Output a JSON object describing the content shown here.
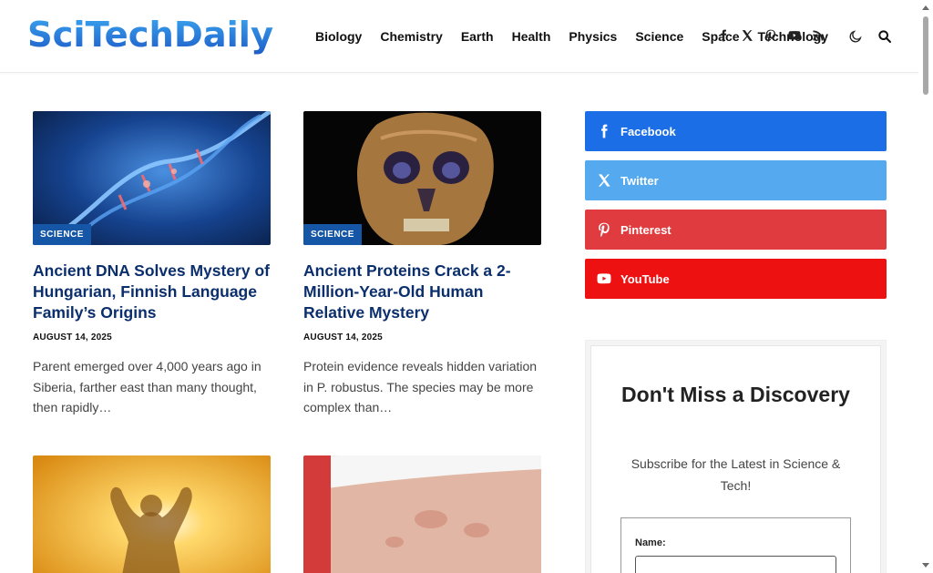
{
  "site": {
    "logo_text": "SciTechDaily"
  },
  "nav": {
    "items": [
      "Biology",
      "Chemistry",
      "Earth",
      "Health",
      "Physics",
      "Science",
      "Space",
      "Technology"
    ]
  },
  "header_social": [
    "facebook-icon",
    "x-twitter-icon",
    "pinterest-icon",
    "youtube-icon",
    "rss-icon"
  ],
  "header_tools": [
    "dark-mode-icon",
    "search-icon"
  ],
  "articles": [
    {
      "category": "SCIENCE",
      "title": "Ancient DNA Solves Mystery of Hungarian, Finnish Language Family’s Origins",
      "date": "AUGUST 14, 2025",
      "excerpt": "Parent emerged over 4,000 years ago in Siberia, farther east than many thought, then rapidly…"
    },
    {
      "category": "SCIENCE",
      "title": "Ancient Proteins Crack a 2-Million-Year-Old Human Relative Mystery",
      "date": "AUGUST 14, 2025",
      "excerpt": "Protein evidence reveals hidden variation in P. robustus. The species may be more complex than…"
    },
    {
      "category": "",
      "title": "",
      "date": "",
      "excerpt": ""
    },
    {
      "category": "",
      "title": "",
      "date": "",
      "excerpt": ""
    }
  ],
  "sidebar": {
    "social_buttons": [
      {
        "label": "Facebook",
        "icon": "facebook-icon",
        "color": "#1b6ee6"
      },
      {
        "label": "Twitter",
        "icon": "x-twitter-icon",
        "color": "#55a9ee"
      },
      {
        "label": "Pinterest",
        "icon": "pinterest-icon",
        "color": "#e03b3f"
      },
      {
        "label": "YouTube",
        "icon": "youtube-icon",
        "color": "#ee1111"
      }
    ],
    "newsletter": {
      "title": "Don't Miss a Discovery",
      "subtitle": "Subscribe for the Latest in Science & Tech!",
      "name_label": "Name:"
    }
  },
  "colors": {
    "brand_blue": "#1556a6",
    "headline_blue": "#0b2f6d"
  }
}
